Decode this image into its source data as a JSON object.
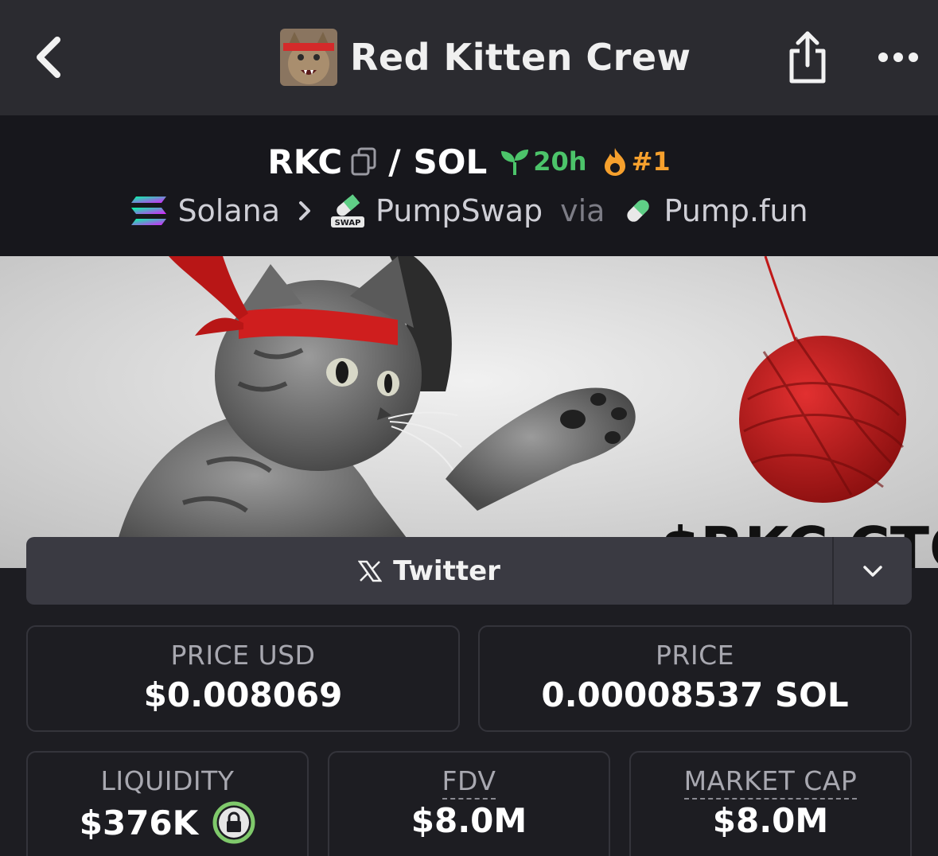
{
  "header": {
    "title": "Red Kitten Crew",
    "back_icon": "chevron-left-icon",
    "share_icon": "share-icon",
    "more_icon": "more-horizontal-icon"
  },
  "pair": {
    "base": "RKC",
    "separator": "/",
    "quote": "SOL",
    "age": "20h",
    "rank": "#1",
    "age_color": "#4cc46a",
    "rank_color": "#f6a02d"
  },
  "path": {
    "chain": "Solana",
    "dex": "PumpSwap",
    "via": "via",
    "launchpad": "Pump.fun",
    "dex_badge": "SWAP"
  },
  "banner": {
    "text": "$RKC CTO"
  },
  "twitter": {
    "label": "Twitter"
  },
  "stats": {
    "price_usd": {
      "label": "PRICE USD",
      "value": "$0.008069"
    },
    "price": {
      "label": "PRICE",
      "value": "0.00008537 SOL"
    },
    "liquidity": {
      "label": "LIQUIDITY",
      "value": "$376K"
    },
    "fdv": {
      "label": "FDV",
      "value": "$8.0M"
    },
    "market_cap": {
      "label": "MARKET CAP",
      "value": "$8.0M"
    }
  }
}
